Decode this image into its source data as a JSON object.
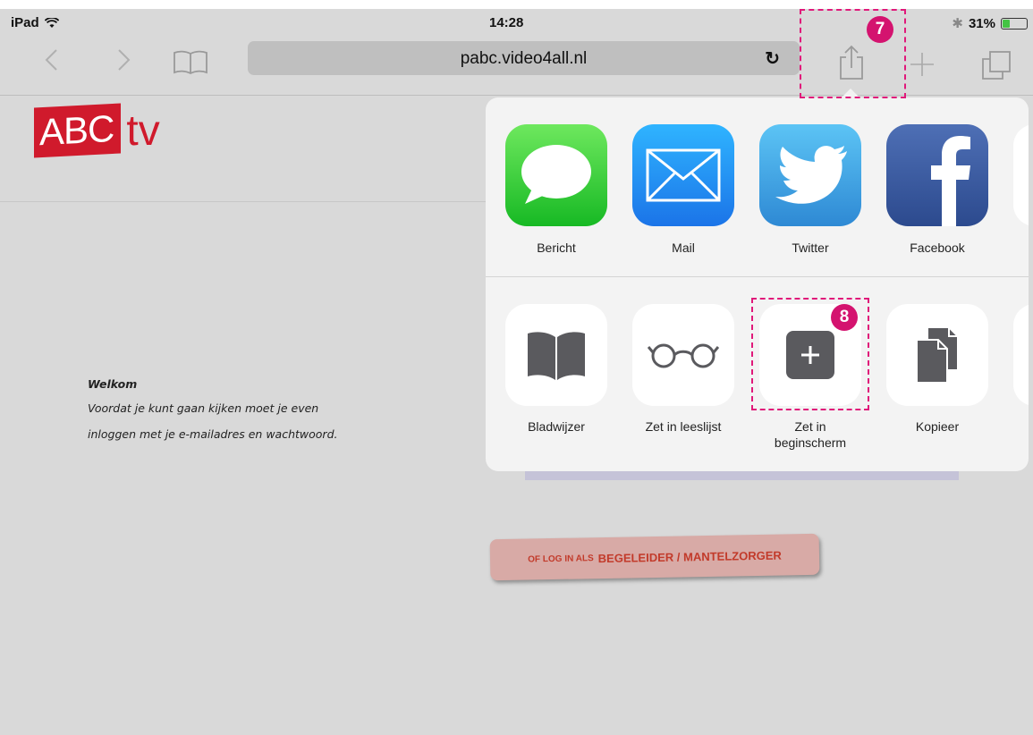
{
  "status_bar": {
    "device": "iPad",
    "time": "14:28",
    "battery": "31%"
  },
  "toolbar": {
    "url": "pabc.video4all.nl"
  },
  "page": {
    "logo_left": "ABC",
    "logo_right": "tv",
    "welcome_title": "Welkom",
    "welcome_line1": "Voordat je kunt gaan kijken moet je even",
    "welcome_line2": "inloggen met je e-mailadres en wachtwoord.",
    "login_small": "OF LOG IN ALS",
    "login_big": "BEGELEIDER / MANTELZORGER"
  },
  "share_sheet": {
    "apps": [
      {
        "label": "Bericht",
        "icon": "messages-icon"
      },
      {
        "label": "Mail",
        "icon": "mail-icon"
      },
      {
        "label": "Twitter",
        "icon": "twitter-icon"
      },
      {
        "label": "Facebook",
        "icon": "facebook-icon"
      }
    ],
    "actions": [
      {
        "label": "Bladwijzer",
        "icon": "bookmark-icon"
      },
      {
        "label": "Zet in leeslijst",
        "icon": "reading-list-icon"
      },
      {
        "label": "Zet in beginscherm",
        "icon": "add-to-home-icon"
      },
      {
        "label": "Kopieer",
        "icon": "copy-icon"
      }
    ]
  },
  "annotations": {
    "step7": "7",
    "step8": "8"
  },
  "colors": {
    "annotation": "#e0197a",
    "badge": "#d4136f",
    "logo": "#d01a2c"
  }
}
